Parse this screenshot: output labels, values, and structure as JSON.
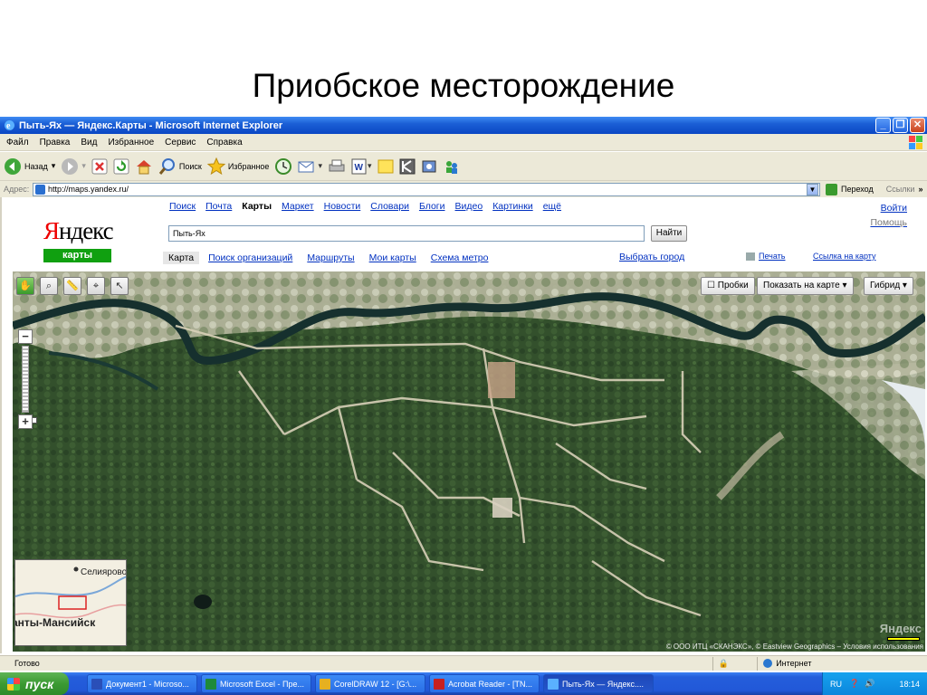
{
  "slide": {
    "title": "Приобское месторождение"
  },
  "window": {
    "title": "Пыть-Ях — Яндекс.Карты - Microsoft Internet Explorer"
  },
  "menu": [
    "Файл",
    "Правка",
    "Вид",
    "Избранное",
    "Сервис",
    "Справка"
  ],
  "toolbar": {
    "back": "Назад",
    "search": "Поиск",
    "favorites": "Избранное"
  },
  "address": {
    "label": "Адрес:",
    "url": "http://maps.yandex.ru/",
    "go": "Переход",
    "links": "Ссылки"
  },
  "yandex": {
    "logo_first": "Я",
    "logo_rest": "ндекс",
    "service": "карты",
    "services": [
      "Поиск",
      "Почта",
      "Карты",
      "Маркет",
      "Новости",
      "Словари",
      "Блоги",
      "Видео",
      "Картинки",
      "ещё"
    ],
    "login": "Войти",
    "help": "Помощь",
    "search_value": "Пыть-Ях",
    "find_button": "Найти",
    "subnav": [
      "Карта",
      "Поиск организаций",
      "Маршруты",
      "Мои карты",
      "Схема метро"
    ],
    "choose_city": "Выбрать город",
    "print": "Печать",
    "map_link": "Ссылка на карту"
  },
  "map": {
    "traffic": "Пробки",
    "show_on_map": "Показать на карте",
    "layer": "Гибрид",
    "minimap_label1": "Селиярово",
    "minimap_label2": "анты-Мансийск",
    "logo": "Яндекс",
    "copyright": "© ООО ИТЦ «СКАНЭКС», © Eastview Geographics – Условия использования"
  },
  "status": {
    "ready": "Готово",
    "zone": "Интернет"
  },
  "taskbar": {
    "start": "пуск",
    "tasks": [
      "Документ1 - Microso...",
      "Microsoft Excel - Пре...",
      "CorelDRAW 12 - [G:\\...",
      "Acrobat Reader - [TN...",
      "Пыть-Ях — Яндекс...."
    ],
    "lang": "RU",
    "clock": "18:14"
  },
  "colors": {
    "xp_blue": "#245edb",
    "yandex_green": "#10a010",
    "link": "#0030c0"
  }
}
